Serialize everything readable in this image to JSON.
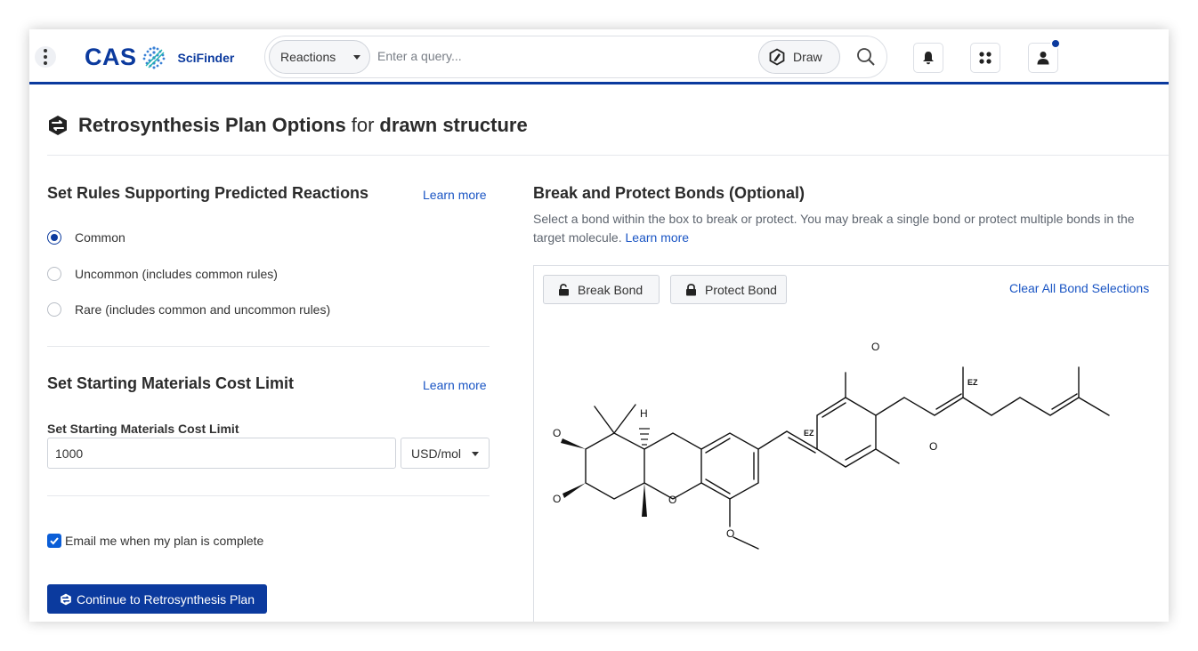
{
  "header": {
    "brand": "CAS",
    "product": "SciFinder",
    "search": {
      "scope": "Reactions",
      "placeholder": "Enter a query...",
      "draw_label": "Draw"
    },
    "icons": [
      "menu-icon",
      "bell-icon",
      "apps-grid-icon",
      "user-icon",
      "search-icon"
    ]
  },
  "page": {
    "title_bold": "Retrosynthesis Plan Options",
    "title_join": "for",
    "title_target": "drawn structure"
  },
  "rules": {
    "heading": "Set Rules Supporting Predicted Reactions",
    "learn_more": "Learn more",
    "options": [
      {
        "label": "Common",
        "selected": true
      },
      {
        "label": "Uncommon (includes common rules)",
        "selected": false
      },
      {
        "label": "Rare (includes common and uncommon rules)",
        "selected": false
      }
    ]
  },
  "cost": {
    "heading": "Set Starting Materials Cost Limit",
    "learn_more": "Learn more",
    "field_label": "Set Starting Materials Cost Limit",
    "value": "1000",
    "unit": "USD/mol"
  },
  "email": {
    "label": "Email me when my plan is complete",
    "checked": true
  },
  "continue_label": "Continue to Retrosynthesis Plan",
  "bonds": {
    "heading": "Break and Protect Bonds (Optional)",
    "description": "Select a bond within the box to break or protect. You may break a single bond or protect multiple bonds in the target molecule.",
    "learn_more": "Learn more",
    "break_label": "Break Bond",
    "protect_label": "Protect Bond",
    "clear_label": "Clear All Bond Selections",
    "atom_labels": {
      "o": "O",
      "h": "H",
      "ez": "EZ"
    }
  },
  "colors": {
    "brand_blue": "#0b3a9e",
    "link_blue": "#1a55c4"
  }
}
